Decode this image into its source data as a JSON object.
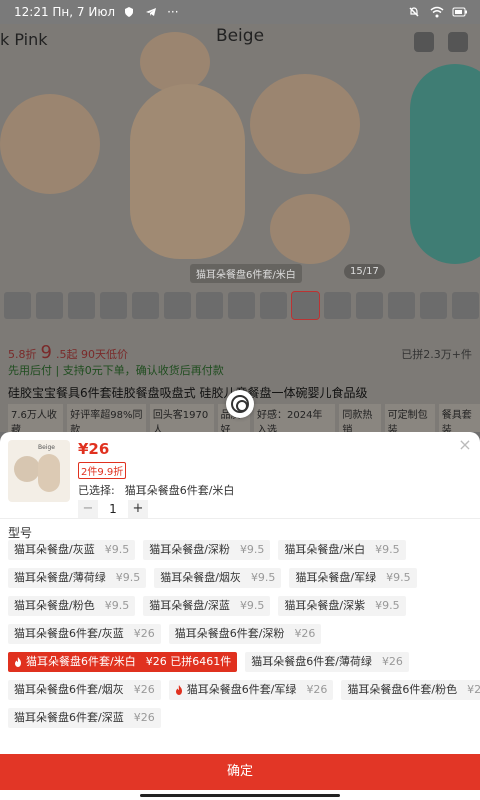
{
  "status_bar": {
    "time_date": "12:21 Пн, 7 Июл",
    "more": "···"
  },
  "product": {
    "color_label_top": "Beige",
    "color_label_left": "k Pink",
    "image_caption": "猫耳朵餐盘6件套/米白",
    "image_pager": "15/17",
    "price_prefix": "5.8折",
    "price_big": "9",
    "price_suffix": ".5起 90天低价",
    "sold_count": "已拼2.3万+件",
    "promo_text": "先用后付 | 支持0元下单，确认收货后再付款",
    "title": "硅胶宝宝餐具6件套硅胶餐盘吸盘式 硅胶儿童餐盘一体碗婴儿食品级",
    "tags": [
      "7.6万人收藏",
      "好评率超98%同款",
      "回头客1970人",
      "品质好",
      "好感：2024年入选",
      "同款热销",
      "可定制包装",
      "餐具套装"
    ]
  },
  "selector": {
    "price": "¥26",
    "badge": "2件9.9折",
    "chosen_label": "已选择:",
    "chosen_value": "猫耳朵餐盘6件套/米白",
    "brand_mark": "Beige",
    "minus": "−",
    "quantity": "1",
    "plus": "+",
    "section_title": "型号",
    "confirm_label": "确定",
    "close_glyph": "×",
    "accent_color": "#e0311f"
  },
  "options": [
    [
      {
        "label": "猫耳朵餐盘/灰蓝",
        "price": "¥9.5"
      },
      {
        "label": "猫耳朵餐盘/深粉",
        "price": "¥9.5"
      },
      {
        "label": "猫耳朵餐盘/米白",
        "price": "¥9.5"
      }
    ],
    [
      {
        "label": "猫耳朵餐盘/薄荷绿",
        "price": "¥9.5"
      },
      {
        "label": "猫耳朵餐盘/烟灰",
        "price": "¥9.5"
      },
      {
        "label": "猫耳朵餐盘/军绿",
        "price": "¥9.5"
      }
    ],
    [
      {
        "label": "猫耳朵餐盘/粉色",
        "price": "¥9.5"
      },
      {
        "label": "猫耳朵餐盘/深蓝",
        "price": "¥9.5"
      },
      {
        "label": "猫耳朵餐盘/深紫",
        "price": "¥9.5"
      }
    ],
    [
      {
        "label": "猫耳朵餐盘6件套/灰蓝",
        "price": "¥26"
      },
      {
        "label": "猫耳朵餐盘6件套/深粉",
        "price": "¥26"
      }
    ],
    [
      {
        "label": "猫耳朵餐盘6件套/米白",
        "price": "¥26 已拼6461件",
        "active": true,
        "hot": true
      },
      {
        "label": "猫耳朵餐盘6件套/薄荷绿",
        "price": "¥26"
      }
    ],
    [
      {
        "label": "猫耳朵餐盘6件套/烟灰",
        "price": "¥26"
      },
      {
        "label": "猫耳朵餐盘6件套/军绿",
        "price": "¥26",
        "hot": true
      },
      {
        "label": "猫耳朵餐盘6件套/粉色",
        "price": "¥26"
      }
    ],
    [
      {
        "label": "猫耳朵餐盘6件套/深蓝",
        "price": "¥26"
      }
    ]
  ]
}
